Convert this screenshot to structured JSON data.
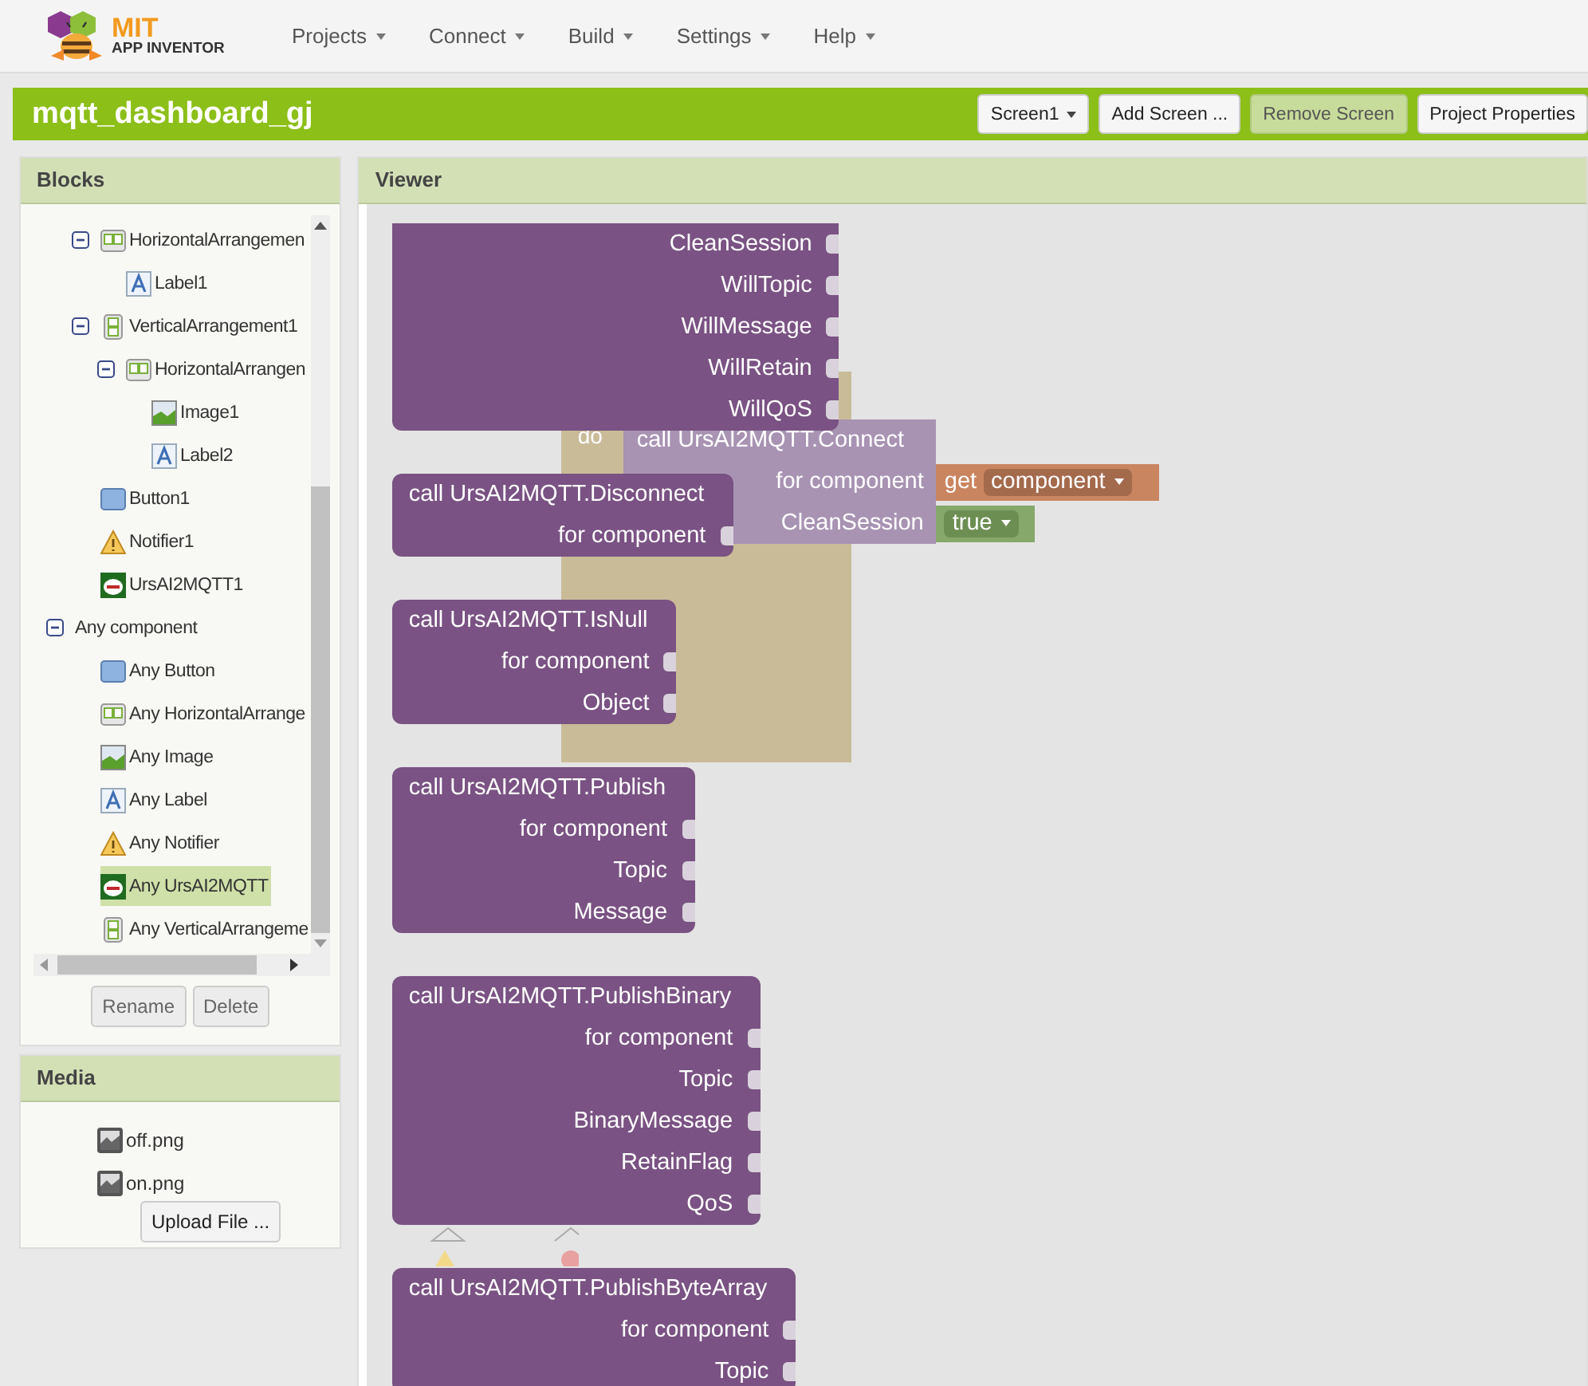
{
  "header": {
    "logo": {
      "title": "MIT",
      "subtitle": "APP INVENTOR"
    },
    "menus": [
      {
        "label": "Projects"
      },
      {
        "label": "Connect"
      },
      {
        "label": "Build"
      },
      {
        "label": "Settings"
      },
      {
        "label": "Help"
      }
    ]
  },
  "project_bar": {
    "title": "mqtt_dashboard_gj",
    "buttons": [
      {
        "label": "Screen1",
        "kind": "dropdown",
        "disabled": false
      },
      {
        "label": "Add Screen ...",
        "kind": "button",
        "disabled": false
      },
      {
        "label": "Remove Screen",
        "kind": "button",
        "disabled": true
      },
      {
        "label": "Project Properties",
        "kind": "button",
        "disabled": false
      }
    ]
  },
  "blocks_panel": {
    "title": "Blocks",
    "tree": {
      "continued_children": [
        {
          "label": "HorizontalArrangemen",
          "kind": "horizontal",
          "expanded": true,
          "selected": false,
          "children": [
            {
              "label": "Label1",
              "kind": "label",
              "selected": false
            }
          ]
        },
        {
          "label": "VerticalArrangement1",
          "kind": "vertical",
          "expanded": true,
          "selected": false,
          "children": [
            {
              "label": "HorizontalArrangen",
              "kind": "horizontal",
              "expanded": true,
              "selected": false,
              "children": [
                {
                  "label": "Image1",
                  "kind": "image",
                  "selected": false
                },
                {
                  "label": "Label2",
                  "kind": "label",
                  "selected": false
                }
              ]
            }
          ]
        },
        {
          "label": "Button1",
          "kind": "button",
          "selected": false
        },
        {
          "label": "Notifier1",
          "kind": "notifier",
          "selected": false
        },
        {
          "label": "UrsAI2MQTT1",
          "kind": "extension",
          "selected": false
        }
      ],
      "items": [
        {
          "label": "Any component",
          "expanded": true,
          "selected": false,
          "children": [
            {
              "label": "Any Button",
              "kind": "button",
              "selected": false
            },
            {
              "label": "Any HorizontalArrange",
              "kind": "horizontal",
              "selected": false
            },
            {
              "label": "Any Image",
              "kind": "image",
              "selected": false
            },
            {
              "label": "Any Label",
              "kind": "label",
              "selected": false
            },
            {
              "label": "Any Notifier",
              "kind": "notifier",
              "selected": false
            },
            {
              "label": "Any UrsAI2MQTT",
              "kind": "extension",
              "selected": true
            },
            {
              "label": "Any VerticalArrangeme",
              "kind": "vertical",
              "selected": false
            }
          ]
        }
      ]
    },
    "buttons": [
      {
        "label": "Rename",
        "disabled": true
      },
      {
        "label": "Delete",
        "disabled": true
      }
    ]
  },
  "media_panel": {
    "title": "Media",
    "files": [
      {
        "name": "off.png"
      },
      {
        "name": "on.png"
      }
    ],
    "upload_button": "Upload File ..."
  },
  "viewer": {
    "title": "Viewer",
    "blocks": [
      {
        "cut_top": true,
        "sockets": [
          "CleanSession",
          "WillTopic",
          "WillMessage",
          "WillRetain",
          "WillQoS"
        ]
      },
      {
        "cut_top": false,
        "title": "call UrsAI2MQTT.Disconnect",
        "sockets": [
          "for component"
        ]
      },
      {
        "cut_top": false,
        "title": "call UrsAI2MQTT.IsNull",
        "sockets": [
          "for component",
          "Object"
        ]
      },
      {
        "cut_top": false,
        "title": "call UrsAI2MQTT.Publish",
        "sockets": [
          "for component",
          "Topic",
          "Message"
        ]
      },
      {
        "cut_top": false,
        "title": "call UrsAI2MQTT.PublishBinary",
        "sockets": [
          "for component",
          "Topic",
          "BinaryMessage",
          "RetainFlag",
          "QoS"
        ]
      },
      {
        "cut_top": false,
        "title": "call UrsAI2MQTT.PublishByteArray",
        "sockets": [
          "for component",
          "Topic"
        ]
      }
    ],
    "faded_block": {
      "do_label": "do",
      "title": "call UrsAI2MQTT.Connect",
      "sockets": [
        {
          "label": "for component",
          "value": {
            "kind": "get",
            "keyword": "get",
            "name": "component"
          }
        },
        {
          "label": "CleanSession",
          "value": {
            "kind": "logic",
            "name": "true"
          }
        }
      ]
    }
  }
}
